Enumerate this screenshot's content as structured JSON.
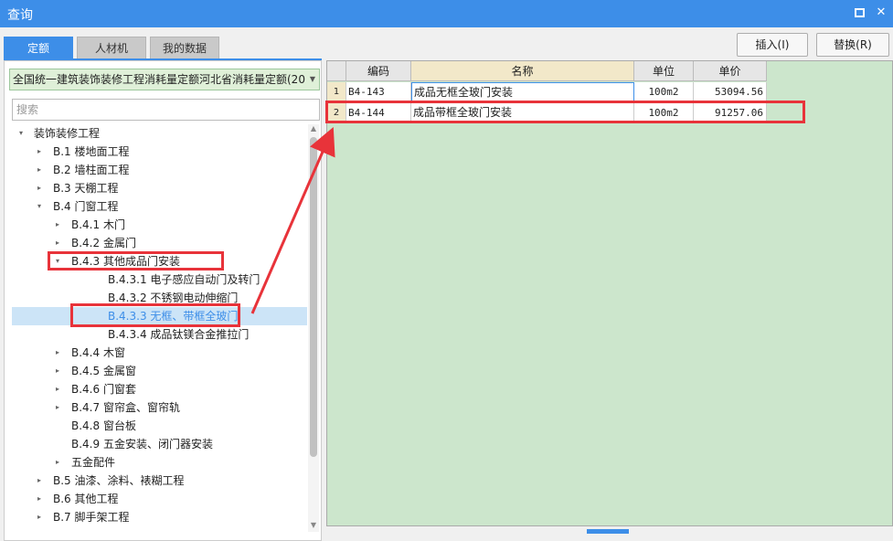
{
  "window": {
    "title": "查询"
  },
  "tabs": [
    "定额",
    "人材机",
    "我的数据"
  ],
  "buttons": {
    "insert": "插入(I)",
    "replace": "替换(R)"
  },
  "library": {
    "selected": "全国统一建筑装饰装修工程消耗量定额河北省消耗量定额(20"
  },
  "search": {
    "placeholder": "搜索"
  },
  "tree": [
    {
      "label": "装饰装修工程",
      "level": 0,
      "expander": "▾"
    },
    {
      "label": "B.1 楼地面工程",
      "level": 1,
      "expander": "▸"
    },
    {
      "label": "B.2 墙柱面工程",
      "level": 1,
      "expander": "▸"
    },
    {
      "label": "B.3 天棚工程",
      "level": 1,
      "expander": "▸"
    },
    {
      "label": "B.4 门窗工程",
      "level": 1,
      "expander": "▾"
    },
    {
      "label": "B.4.1 木门",
      "level": 2,
      "expander": "▸"
    },
    {
      "label": "B.4.2 金属门",
      "level": 2,
      "expander": "▸"
    },
    {
      "label": "B.4.3 其他成品门安装",
      "level": 2,
      "expander": "▾"
    },
    {
      "label": "B.4.3.1 电子感应自动门及转门",
      "level": 3,
      "expander": ""
    },
    {
      "label": "B.4.3.2 不锈钢电动伸缩门",
      "level": 3,
      "expander": ""
    },
    {
      "label": "B.4.3.3 无框、带框全玻门",
      "level": 3,
      "expander": "",
      "selected": true
    },
    {
      "label": "B.4.3.4 成品钛镁合金推拉门",
      "level": 3,
      "expander": ""
    },
    {
      "label": "B.4.4 木窗",
      "level": 2,
      "expander": "▸"
    },
    {
      "label": "B.4.5 金属窗",
      "level": 2,
      "expander": "▸"
    },
    {
      "label": "B.4.6 门窗套",
      "level": 2,
      "expander": "▸"
    },
    {
      "label": "B.4.7 窗帘盒、窗帘轨",
      "level": 2,
      "expander": "▸"
    },
    {
      "label": "B.4.8 窗台板",
      "level": 2,
      "expander": ""
    },
    {
      "label": "B.4.9 五金安装、闭门器安装",
      "level": 2,
      "expander": ""
    },
    {
      "label": "五金配件",
      "level": 2,
      "expander": "▸"
    },
    {
      "label": "B.5 油漆、涂料、裱糊工程",
      "level": 1,
      "expander": "▸"
    },
    {
      "label": "B.6 其他工程",
      "level": 1,
      "expander": "▸"
    },
    {
      "label": "B.7 脚手架工程",
      "level": 1,
      "expander": "▸"
    }
  ],
  "table": {
    "headers": [
      "编码",
      "名称",
      "单位",
      "单价"
    ],
    "rows": [
      {
        "num": "1",
        "code": "B4-143",
        "name": "成品无框全玻门安装",
        "unit": "100m2",
        "price": "53094.56"
      },
      {
        "num": "2",
        "code": "B4-144",
        "name": "成品带框全玻门安装",
        "unit": "100m2",
        "price": "91257.06"
      }
    ]
  },
  "colors": {
    "accent": "#3d8ee8",
    "highlight": "#e8333a",
    "grid_bg": "#cce6cc"
  }
}
